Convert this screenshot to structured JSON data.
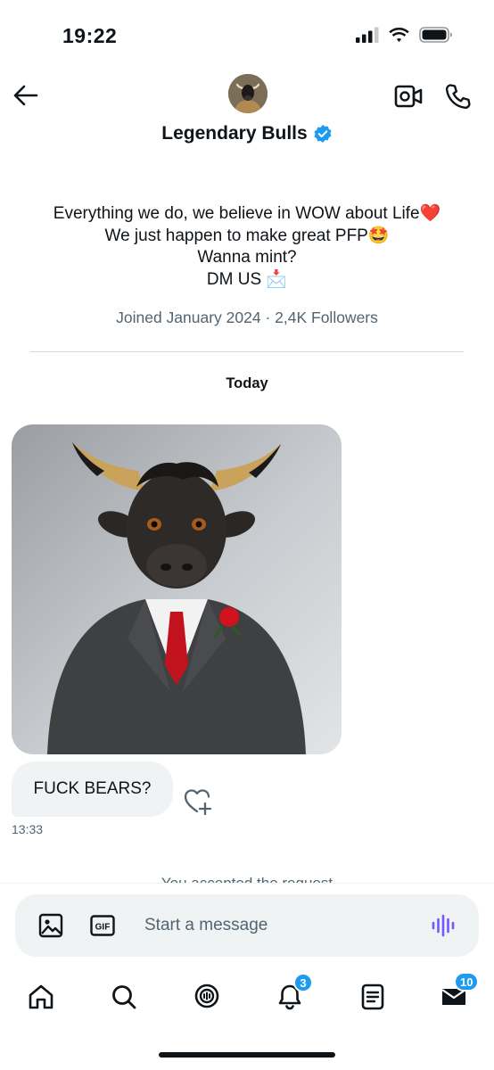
{
  "status_bar": {
    "time": "19:22",
    "icons": [
      "cellular-signal-icon",
      "wifi-icon",
      "battery-icon"
    ]
  },
  "header": {
    "back_icon": "arrow-left-icon",
    "display_name": "Legendary Bulls",
    "verified": true,
    "verified_color": "#1d9bf0",
    "actions": [
      "video-call-icon",
      "phone-call-icon"
    ]
  },
  "profile": {
    "bio_lines": [
      "Everything we do, we believe in WOW about Life❤️",
      "We just happen to make great PFP🤩",
      "Wanna mint?",
      "DM US 📩"
    ],
    "meta": "Joined January 2024 · 2,4K Followers"
  },
  "conversation": {
    "day_label": "Today",
    "messages": [
      {
        "type": "image"
      },
      {
        "type": "text",
        "text": "FUCK BEARS?",
        "time": "13:33"
      }
    ],
    "react_icon": "heart-plus-icon",
    "partial_notice": "You accepted the request"
  },
  "composer": {
    "placeholder": "Start a message",
    "buttons": [
      "image-icon",
      "gif-icon"
    ],
    "voice_icon": "voice-waveform-icon",
    "accent_color": "#7856ff"
  },
  "bottom_nav": {
    "items": [
      {
        "icon": "home-icon"
      },
      {
        "icon": "search-icon"
      },
      {
        "icon": "spaces-icon"
      },
      {
        "icon": "bell-icon",
        "badge": "3"
      },
      {
        "icon": "lists-icon"
      },
      {
        "icon": "mail-icon",
        "badge": "10"
      }
    ],
    "badge_color": "#1d9bf0"
  }
}
